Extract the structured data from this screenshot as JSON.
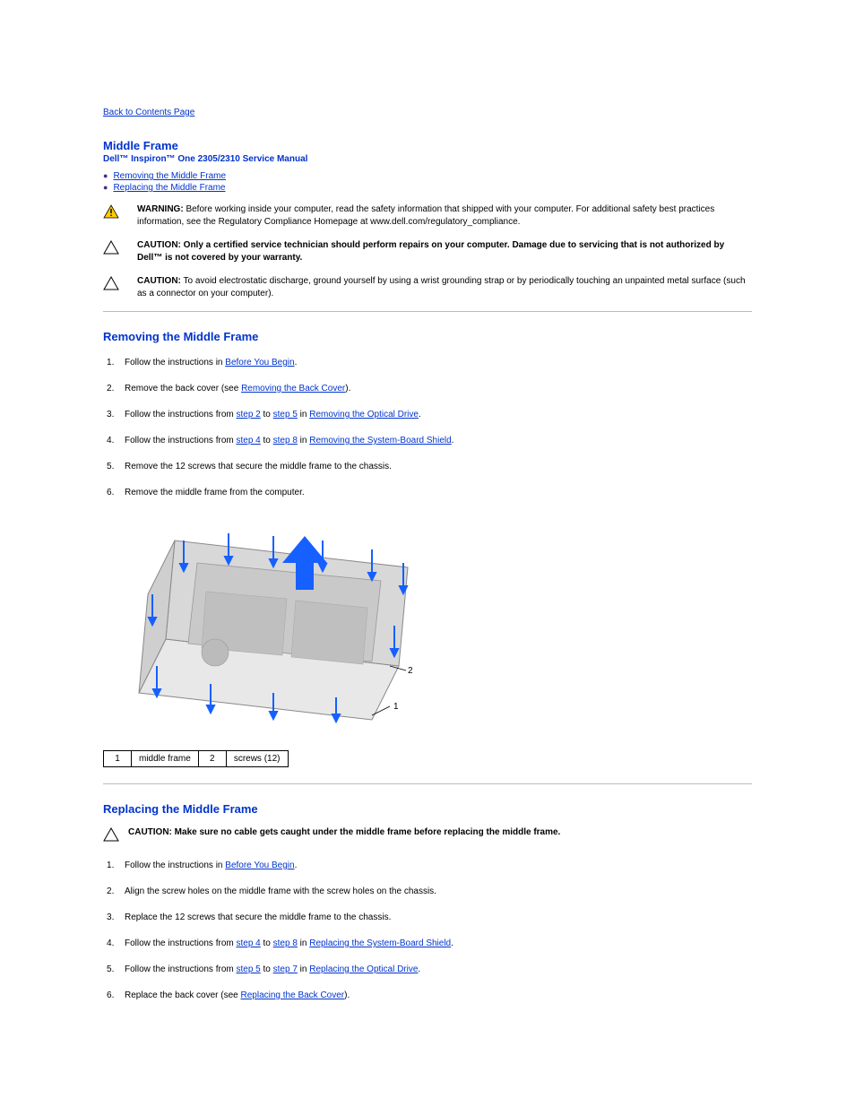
{
  "nav": {
    "back": "Back to Contents Page"
  },
  "header": {
    "title": "Middle Frame",
    "subtitle": "Dell™ Inspiron™ One 2305/2310 Service Manual"
  },
  "toc": {
    "removing": "Removing the Middle Frame",
    "replacing": "Replacing the Middle Frame"
  },
  "warnings": {
    "warning_label": "WARNING:",
    "warning_text": "Before working inside your computer, read the safety information that shipped with your computer. For additional safety best practices information, see the Regulatory Compliance Homepage at www.dell.com/regulatory_compliance.",
    "caution1_label": "CAUTION:",
    "caution1_text": "Only a certified service technician should perform repairs on your computer. Damage due to servicing that is not authorized by Dell™ is not covered by your warranty.",
    "caution2_label": "CAUTION:",
    "caution2_text": "To avoid electrostatic discharge, ground yourself by using a wrist grounding strap or by periodically touching an unpainted metal surface (such as a connector on your computer)."
  },
  "section_remove": {
    "heading": "Removing the Middle Frame",
    "steps": {
      "s1a": "Follow the instructions in ",
      "s1_link": "Before You Begin",
      "s1b": ".",
      "s2a": "Remove the back cover (see ",
      "s2_link": "Removing the Back Cover",
      "s2b": ").",
      "s3a": "Follow the instructions from ",
      "s3_link1": "step 2",
      "s3_mid1": " to ",
      "s3_link2": "step 5",
      "s3_mid2": " in ",
      "s3_link3": "Removing the Optical Drive",
      "s3b": ".",
      "s4a": "Follow the instructions from ",
      "s4_link1": "step 4",
      "s4_mid1": " to ",
      "s4_link2": "step 8",
      "s4_mid2": " in ",
      "s4_link3": "Removing the System-Board Shield",
      "s4b": ".",
      "s5": "Remove the 12 screws that secure the middle frame to the chassis.",
      "s6": "Remove the middle frame from the computer."
    }
  },
  "callouts": {
    "c1n": "1",
    "c1t": "middle frame",
    "c2n": "2",
    "c2t": "screws (12)"
  },
  "section_replace": {
    "heading": "Replacing the Middle Frame",
    "caution_label": "CAUTION:",
    "caution_text": "Make sure no cable gets caught under the middle frame before replacing the middle frame.",
    "steps": {
      "s1a": "Follow the instructions in ",
      "s1_link": "Before You Begin",
      "s1b": ".",
      "s2": "Align the screw holes on the middle frame with the screw holes on the chassis.",
      "s3": "Replace the 12 screws that secure the middle frame to the chassis.",
      "s4a": "Follow the instructions from ",
      "s4_link1": "step 4",
      "s4_mid1": " to ",
      "s4_link2": "step 8",
      "s4_mid2": " in ",
      "s4_link3": "Replacing the System-Board Shield",
      "s4b": ".",
      "s5a": "Follow the instructions from ",
      "s5_link1": "step 5",
      "s5_mid1": " to ",
      "s5_link2": "step 7",
      "s5_mid2": " in ",
      "s5_link3": "Replacing the Optical Drive",
      "s5b": ".",
      "s6a": "Replace the back cover (see ",
      "s6_link": "Replacing the Back Cover",
      "s6b": ")."
    }
  }
}
